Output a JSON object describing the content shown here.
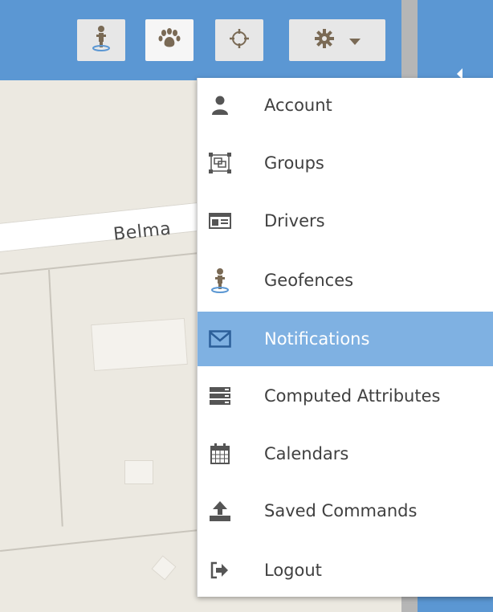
{
  "map": {
    "street_label": "Belma"
  },
  "toolbar": {
    "buttons": [
      {
        "name": "geofence-tool",
        "icon": "geofence-icon"
      },
      {
        "name": "paw-tool",
        "icon": "paw-icon"
      },
      {
        "name": "locate-tool",
        "icon": "crosshair-icon"
      },
      {
        "name": "settings-dropdown",
        "icon": "gear-icon",
        "caret": "caret-down-icon"
      }
    ],
    "collapse_icon": "caret-left-icon"
  },
  "menu": {
    "items": [
      {
        "label": "Account",
        "icon": "user-icon"
      },
      {
        "label": "Groups",
        "icon": "groups-icon"
      },
      {
        "label": "Drivers",
        "icon": "id-card-icon"
      },
      {
        "label": "Geofences",
        "icon": "geofence-icon"
      },
      {
        "label": "Notifications",
        "icon": "envelope-icon",
        "active": true
      },
      {
        "label": "Computed Attributes",
        "icon": "server-icon"
      },
      {
        "label": "Calendars",
        "icon": "calendar-icon"
      },
      {
        "label": "Saved Commands",
        "icon": "upload-icon"
      },
      {
        "label": "Logout",
        "icon": "sign-out-icon"
      }
    ]
  },
  "colors": {
    "toolbar_blue": "#5b97d3",
    "active_item": "#7fb1e2",
    "map_background": "#ece9e1"
  }
}
